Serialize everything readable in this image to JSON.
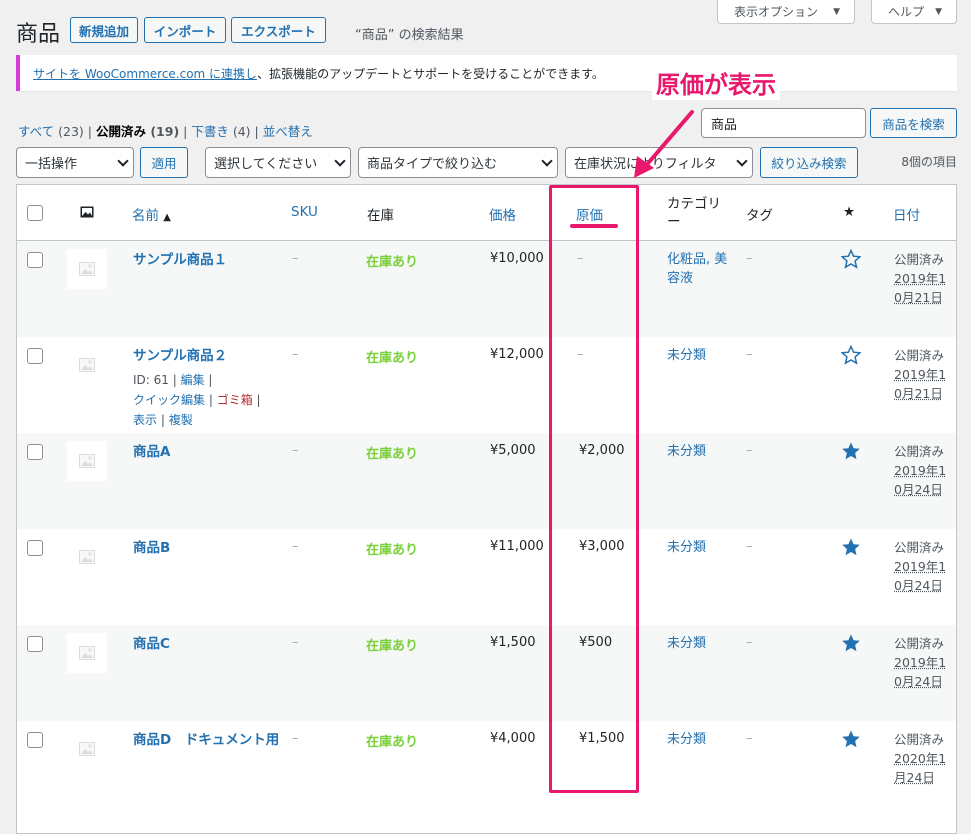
{
  "screen_meta": {
    "options_label": "表示オプション",
    "help_label": "ヘルプ"
  },
  "header": {
    "title": "商品",
    "add_new": "新規追加",
    "import": "インポート",
    "export": "エクスポート",
    "subtitle": "“商品” の検索結果"
  },
  "notice": {
    "link_text": "サイトを WooCommerce.com に連携し",
    "text": "、拡張機能のアップデートとサポートを受けることができます。"
  },
  "annotation": {
    "label": "原価が表示",
    "color": "#e8186c"
  },
  "views": [
    {
      "label": "すべて",
      "count": "(23)",
      "sep": " | "
    },
    {
      "label": "公開済み",
      "count": "(19)",
      "sep": " | "
    },
    {
      "label": "下書き",
      "count": "(4)",
      "sep": " | "
    },
    {
      "label": "並べ替え",
      "count": "",
      "sep": ""
    }
  ],
  "search": {
    "value": "商品",
    "button": "商品を検索"
  },
  "filters": {
    "bulk_action": "一括操作",
    "apply": "適用",
    "category": "選択してください",
    "product_type": "商品タイプで絞り込む",
    "stock_status": "在庫状況によりフィルタ",
    "filter_button": "絞り込み検索",
    "items_count": "8個の項目"
  },
  "columns": {
    "name": "名前",
    "sort_icon": "▲",
    "sku": "SKU",
    "stock": "在庫",
    "price": "価格",
    "cost": "原価",
    "categories": "カテゴリー",
    "tags": "タグ",
    "featured": "★",
    "date": "日付"
  },
  "row_actions": {
    "id": "ID: 61",
    "edit": "編集",
    "quick_edit": "クイック編集",
    "trash": "ゴミ箱",
    "view": "表示",
    "duplicate": "複製"
  },
  "products": [
    {
      "name": "サンプル商品１",
      "sku": "–",
      "stock": "在庫あり",
      "price": "¥10,000",
      "cost": "–",
      "category": "化粧品, 美容液",
      "tags": "–",
      "featured": false,
      "status": "公開済み",
      "date": "2019年10月21日"
    },
    {
      "name": "サンプル商品２",
      "sku": "–",
      "stock": "在庫あり",
      "price": "¥12,000",
      "cost": "–",
      "category": "未分類",
      "tags": "–",
      "featured": false,
      "status": "公開済み",
      "date": "2019年10月21日"
    },
    {
      "name": "商品A",
      "sku": "–",
      "stock": "在庫あり",
      "price": "¥5,000",
      "cost": "¥2,000",
      "category": "未分類",
      "tags": "–",
      "featured": true,
      "status": "公開済み",
      "date": "2019年10月24日"
    },
    {
      "name": "商品B",
      "sku": "–",
      "stock": "在庫あり",
      "price": "¥11,000",
      "cost": "¥3,000",
      "category": "未分類",
      "tags": "–",
      "featured": true,
      "status": "公開済み",
      "date": "2019年10月24日"
    },
    {
      "name": "商品C",
      "sku": "–",
      "stock": "在庫あり",
      "price": "¥1,500",
      "cost": "¥500",
      "category": "未分類",
      "tags": "–",
      "featured": true,
      "status": "公開済み",
      "date": "2019年10月24日"
    },
    {
      "name": "商品D　ドキュメント用",
      "sku": "–",
      "stock": "在庫あり",
      "price": "¥4,000",
      "cost": "¥1,500",
      "category": "未分類",
      "tags": "–",
      "featured": true,
      "status": "公開済み",
      "date": "2020年1月24日"
    }
  ]
}
